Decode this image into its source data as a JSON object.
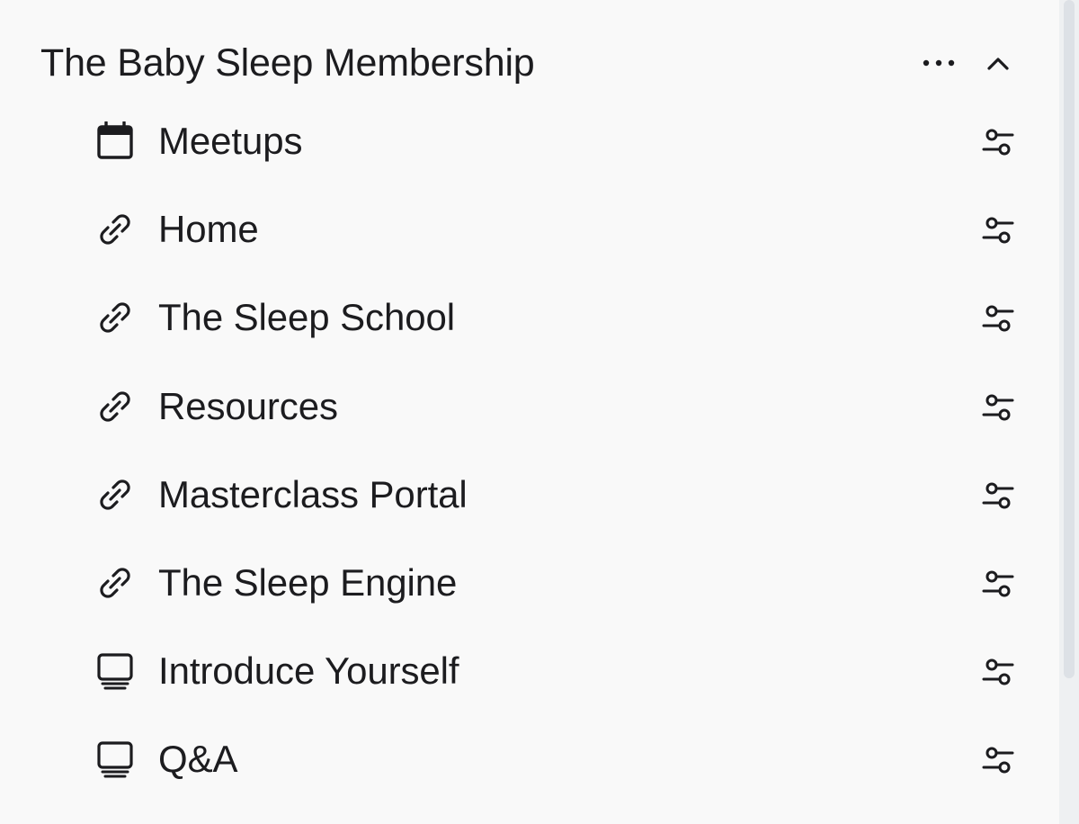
{
  "space": {
    "title": "The Baby Sleep Membership",
    "more_icon": "more-horizontal-icon",
    "collapse_icon": "chevron-up-icon"
  },
  "nav": {
    "items": [
      {
        "label": "Meetups",
        "icon": "calendar-icon"
      },
      {
        "label": "Home",
        "icon": "link-icon"
      },
      {
        "label": "The Sleep School",
        "icon": "link-icon"
      },
      {
        "label": "Resources",
        "icon": "link-icon"
      },
      {
        "label": "Masterclass Portal",
        "icon": "link-icon"
      },
      {
        "label": "The Sleep Engine",
        "icon": "link-icon"
      },
      {
        "label": "Introduce Yourself",
        "icon": "monitor-icon"
      },
      {
        "label": "Q&A",
        "icon": "monitor-icon"
      }
    ],
    "settings_icon": "sliders-icon"
  },
  "colors": {
    "background": "#f9f9f9",
    "text": "#1c1c1f",
    "scrollbar_track": "#eef0f2",
    "scrollbar_thumb": "#dde1e6"
  }
}
